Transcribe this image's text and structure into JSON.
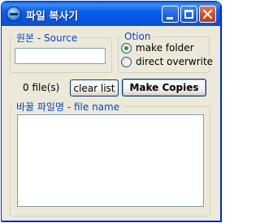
{
  "window": {
    "title": "파일 복사기"
  },
  "source": {
    "legend": "원본 - Source",
    "value": ""
  },
  "option": {
    "legend": "Otion",
    "make_folder": {
      "label": "make folder",
      "checked": true
    },
    "direct_overwrite": {
      "label": "direct overwrite",
      "checked": false
    }
  },
  "toolbar": {
    "file_count": "0 file(s)",
    "clear_label": "clear list",
    "make_label": "Make Copies"
  },
  "filename": {
    "legend": "바꿀 파일명 - file name",
    "value": ""
  },
  "colors": {
    "titlebar": "#0755dc",
    "legend_text": "#0046d5",
    "window_bg": "#ece9d8",
    "radio_dot": "#21a121"
  },
  "icons": [
    "app-icon",
    "minimize-icon",
    "maximize-icon",
    "close-icon"
  ]
}
